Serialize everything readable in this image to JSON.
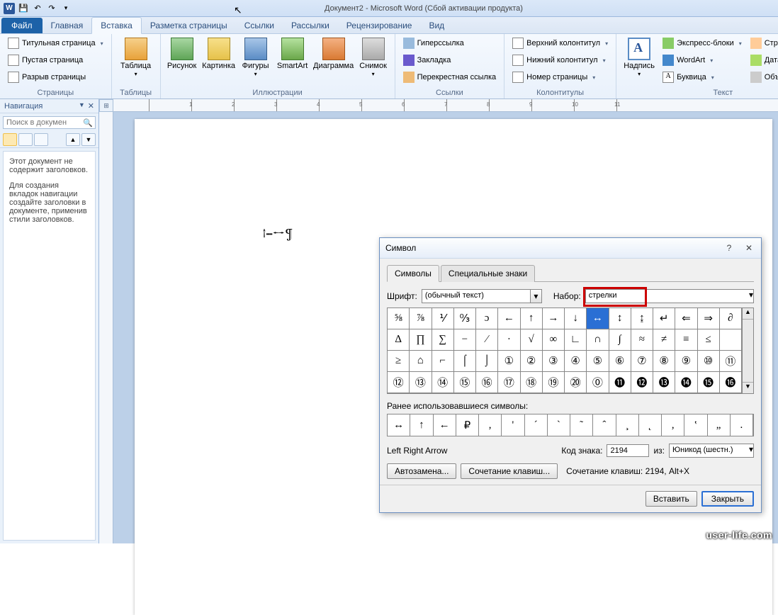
{
  "titlebar": {
    "title": "Документ2 - Microsoft Word (Сбой активации продукта)"
  },
  "tabs": {
    "file": "Файл",
    "items": [
      "Главная",
      "Вставка",
      "Разметка страницы",
      "Ссылки",
      "Рассылки",
      "Рецензирование",
      "Вид"
    ],
    "active": 1
  },
  "ribbon": {
    "pages": {
      "label": "Страницы",
      "cover": "Титульная страница",
      "blank": "Пустая страница",
      "break": "Разрыв страницы"
    },
    "tables": {
      "label": "Таблицы",
      "table": "Таблица"
    },
    "illus": {
      "label": "Иллюстрации",
      "picture": "Рисунок",
      "clip": "Картинка",
      "shapes": "Фигуры",
      "smartart": "SmartArt",
      "chart": "Диаграмма",
      "screenshot": "Снимок"
    },
    "links": {
      "label": "Ссылки",
      "hyper": "Гиперссылка",
      "bookmark": "Закладка",
      "crossref": "Перекрестная ссылка"
    },
    "headfoot": {
      "label": "Колонтитулы",
      "header": "Верхний колонтитул",
      "footer": "Нижний колонтитул",
      "pagenum": "Номер страницы"
    },
    "text": {
      "label": "Текст",
      "textbox": "Надпись",
      "quick": "Экспресс-блоки",
      "wordart": "WordArt",
      "dropcap": "Буквица",
      "sigline": "Строка подпи",
      "datetime": "Дата и время",
      "object": "Объект"
    }
  },
  "nav": {
    "title": "Навигация",
    "search_placeholder": "Поиск в докумен",
    "msg1": "Этот документ не содержит заголовков.",
    "msg2": "Для создания вкладок навигации создайте заголовки в документе, применив стили заголовков."
  },
  "document": {
    "sample": "↑····↔¶"
  },
  "dialog": {
    "title": "Символ",
    "tab_symbols": "Символы",
    "tab_special": "Специальные знаки",
    "font_label": "Шрифт:",
    "font_value": "(обычный текст)",
    "set_label": "Набор:",
    "set_value": "стрелки",
    "grid": [
      [
        "⅝",
        "⅞",
        "⅟",
        "↉",
        "ɔ",
        "←",
        "↑",
        "→",
        "↓",
        "↔",
        "↕",
        "↨",
        "↵",
        "⇐",
        "⇒",
        "∂"
      ],
      [
        "∆",
        "∏",
        "∑",
        "−",
        "∕",
        "∙",
        "√",
        "∞",
        "∟",
        "∩",
        "∫",
        "≈",
        "≠",
        "≡",
        "≤",
        ""
      ],
      [
        "≥",
        "⌂",
        "⌐",
        "⌠",
        "⌡",
        "①",
        "②",
        "③",
        "④",
        "⑤",
        "⑥",
        "⑦",
        "⑧",
        "⑨",
        "⑩",
        "⑪"
      ],
      [
        "⑫",
        "⑬",
        "⑭",
        "⑮",
        "⑯",
        "⑰",
        "⑱",
        "⑲",
        "⑳",
        "⓪",
        "⓫",
        "⓬",
        "⓭",
        "⓮",
        "⓯",
        "⓰"
      ]
    ],
    "selected_row": 0,
    "selected_col": 9,
    "recent_label": "Ранее использовавшиеся символы:",
    "recent": [
      "↔",
      "↑",
      "←",
      "₽",
      ",",
      "'",
      "´",
      "`",
      "˜",
      "ˆ",
      "¸",
      "˛",
      "‚",
      "‛",
      "„",
      "."
    ],
    "char_name": "Left Right Arrow",
    "code_label": "Код знака:",
    "code_value": "2194",
    "from_label": "из:",
    "from_value": "Юникод (шестн.)",
    "btn_auto": "Автозамена...",
    "btn_shortcut": "Сочетание клавиш...",
    "shortcut_text": "Сочетание клавиш: 2194, Alt+X",
    "btn_insert": "Вставить",
    "btn_close": "Закрыть"
  },
  "ruler_nums": [
    "",
    "1",
    "2",
    "3",
    "4",
    "5",
    "6",
    "7",
    "8",
    "9",
    "10",
    "11"
  ],
  "watermark": "user-life.com"
}
